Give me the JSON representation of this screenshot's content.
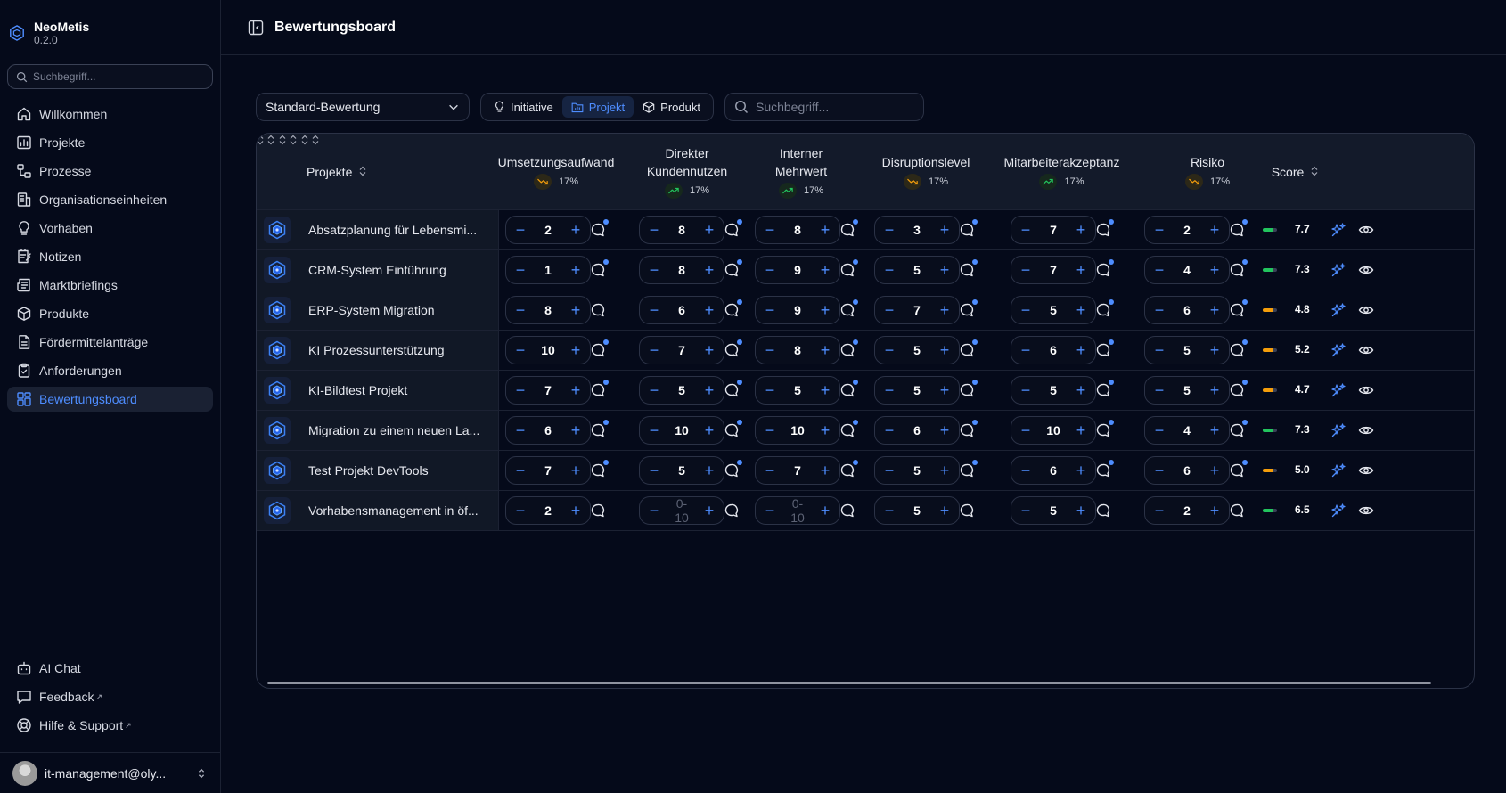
{
  "app": {
    "name": "NeoMetis",
    "version": "0.2.0"
  },
  "sidebar": {
    "search_placeholder": "Suchbegriff...",
    "items": [
      {
        "label": "Willkommen",
        "icon": "home-icon"
      },
      {
        "label": "Projekte",
        "icon": "chart-icon"
      },
      {
        "label": "Prozesse",
        "icon": "workflow-icon"
      },
      {
        "label": "Organisationseinheiten",
        "icon": "building-icon"
      },
      {
        "label": "Vorhaben",
        "icon": "lightbulb-icon"
      },
      {
        "label": "Notizen",
        "icon": "notepad-icon"
      },
      {
        "label": "Marktbriefings",
        "icon": "newspaper-icon"
      },
      {
        "label": "Produkte",
        "icon": "box-icon"
      },
      {
        "label": "Fördermittelanträge",
        "icon": "document-icon"
      },
      {
        "label": "Anforderungen",
        "icon": "clipboard-icon"
      },
      {
        "label": "Bewertungsboard",
        "icon": "grid-icon"
      }
    ],
    "bottom": [
      {
        "label": "AI Chat",
        "icon": "bot-icon"
      },
      {
        "label": "Feedback",
        "icon": "message-icon",
        "ext": "↗"
      },
      {
        "label": "Hilfe & Support",
        "icon": "lifebuoy-icon",
        "ext": "↗"
      }
    ],
    "user": "it-management@oly..."
  },
  "header": {
    "title": "Bewertungsboard"
  },
  "toolbar": {
    "select_value": "Standard-Bewertung",
    "segments": [
      "Initiative",
      "Projekt",
      "Produkt"
    ],
    "search_placeholder": "Suchbegriff..."
  },
  "table": {
    "name_header": "Projekte",
    "score_header": "Score",
    "criteria": [
      {
        "line1": "Umsetzungsaufwand",
        "line2": "",
        "weight": "17%",
        "trend": "down"
      },
      {
        "line1": "Direkter",
        "line2": "Kundennutzen",
        "weight": "17%",
        "trend": "up"
      },
      {
        "line1": "Interner",
        "line2": "Mehrwert",
        "weight": "17%",
        "trend": "up"
      },
      {
        "line1": "Disruptionslevel",
        "line2": "",
        "weight": "17%",
        "trend": "down"
      },
      {
        "line1": "Mitarbeiterakzeptanz",
        "line2": "",
        "weight": "17%",
        "trend": "up"
      },
      {
        "line1": "Risiko",
        "line2": "",
        "weight": "17%",
        "trend": "down"
      }
    ],
    "placeholder": "0-10",
    "rows": [
      {
        "name": "Absatzplanung für Lebensmi...",
        "values": [
          "2",
          "8",
          "8",
          "3",
          "7",
          "2"
        ],
        "notes": [
          true,
          true,
          true,
          true,
          true,
          true
        ],
        "score": "7.7",
        "level": "green"
      },
      {
        "name": "CRM-System Einführung",
        "values": [
          "1",
          "8",
          "9",
          "5",
          "7",
          "4"
        ],
        "notes": [
          true,
          true,
          true,
          true,
          true,
          true
        ],
        "score": "7.3",
        "level": "green"
      },
      {
        "name": "ERP-System Migration",
        "values": [
          "8",
          "6",
          "9",
          "7",
          "5",
          "6"
        ],
        "notes": [
          false,
          true,
          true,
          true,
          true,
          true
        ],
        "score": "4.8",
        "level": "orange"
      },
      {
        "name": "KI Prozessunterstützung",
        "values": [
          "10",
          "7",
          "8",
          "5",
          "6",
          "5"
        ],
        "notes": [
          true,
          true,
          true,
          true,
          true,
          true
        ],
        "score": "5.2",
        "level": "orange"
      },
      {
        "name": "KI-Bildtest Projekt",
        "values": [
          "7",
          "5",
          "5",
          "5",
          "5",
          "5"
        ],
        "notes": [
          true,
          true,
          true,
          true,
          true,
          true
        ],
        "score": "4.7",
        "level": "orange"
      },
      {
        "name": "Migration zu einem neuen La...",
        "values": [
          "6",
          "10",
          "10",
          "6",
          "10",
          "4"
        ],
        "notes": [
          true,
          true,
          true,
          true,
          true,
          true
        ],
        "score": "7.3",
        "level": "green"
      },
      {
        "name": "Test Projekt DevTools",
        "values": [
          "7",
          "5",
          "7",
          "5",
          "6",
          "6"
        ],
        "notes": [
          true,
          true,
          true,
          true,
          true,
          true
        ],
        "score": "5.0",
        "level": "orange"
      },
      {
        "name": "Vorhabensmanagement in öf...",
        "values": [
          "2",
          "",
          "",
          "5",
          "5",
          "2"
        ],
        "notes": [
          false,
          false,
          false,
          false,
          false,
          false
        ],
        "score": "6.5",
        "level": "green"
      }
    ]
  },
  "colors": {
    "accent": "#4e8dff",
    "green": "#22c55e",
    "orange": "#f59e0b",
    "bg": "#050a1a"
  }
}
